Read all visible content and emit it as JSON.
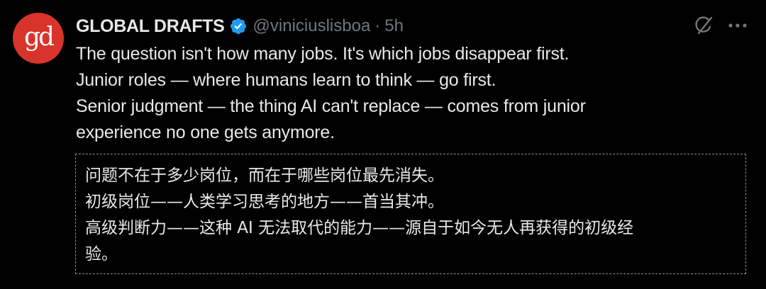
{
  "author": {
    "avatar_text": "gd",
    "name": "GLOBAL DRAFTS",
    "handle": "@viniciuslisboa",
    "separator": "·",
    "time": "5h"
  },
  "colors": {
    "background": "#000000",
    "avatar": "#d9342b",
    "verified": "#1d9bf0",
    "text": "#e7e9ea",
    "muted": "#71767b"
  },
  "icons": {
    "grok": "grok-icon",
    "more": "more-options-icon",
    "verified": "verified-badge-icon"
  },
  "post": {
    "lines": [
      "The question isn't how many jobs. It's which jobs disappear first.",
      "Junior roles — where humans learn to think — go first.",
      "Senior judgment — the thing AI can't replace — comes from junior",
      "experience no one gets anymore."
    ]
  },
  "translation": {
    "lines": [
      "问题不在于多少岗位，而在于哪些岗位最先消失。",
      "初级岗位——人类学习思考的地方——首当其冲。",
      "高级判断力——这种 AI 无法取代的能力——源自于如今无人再获得的初级经",
      "验。"
    ]
  }
}
